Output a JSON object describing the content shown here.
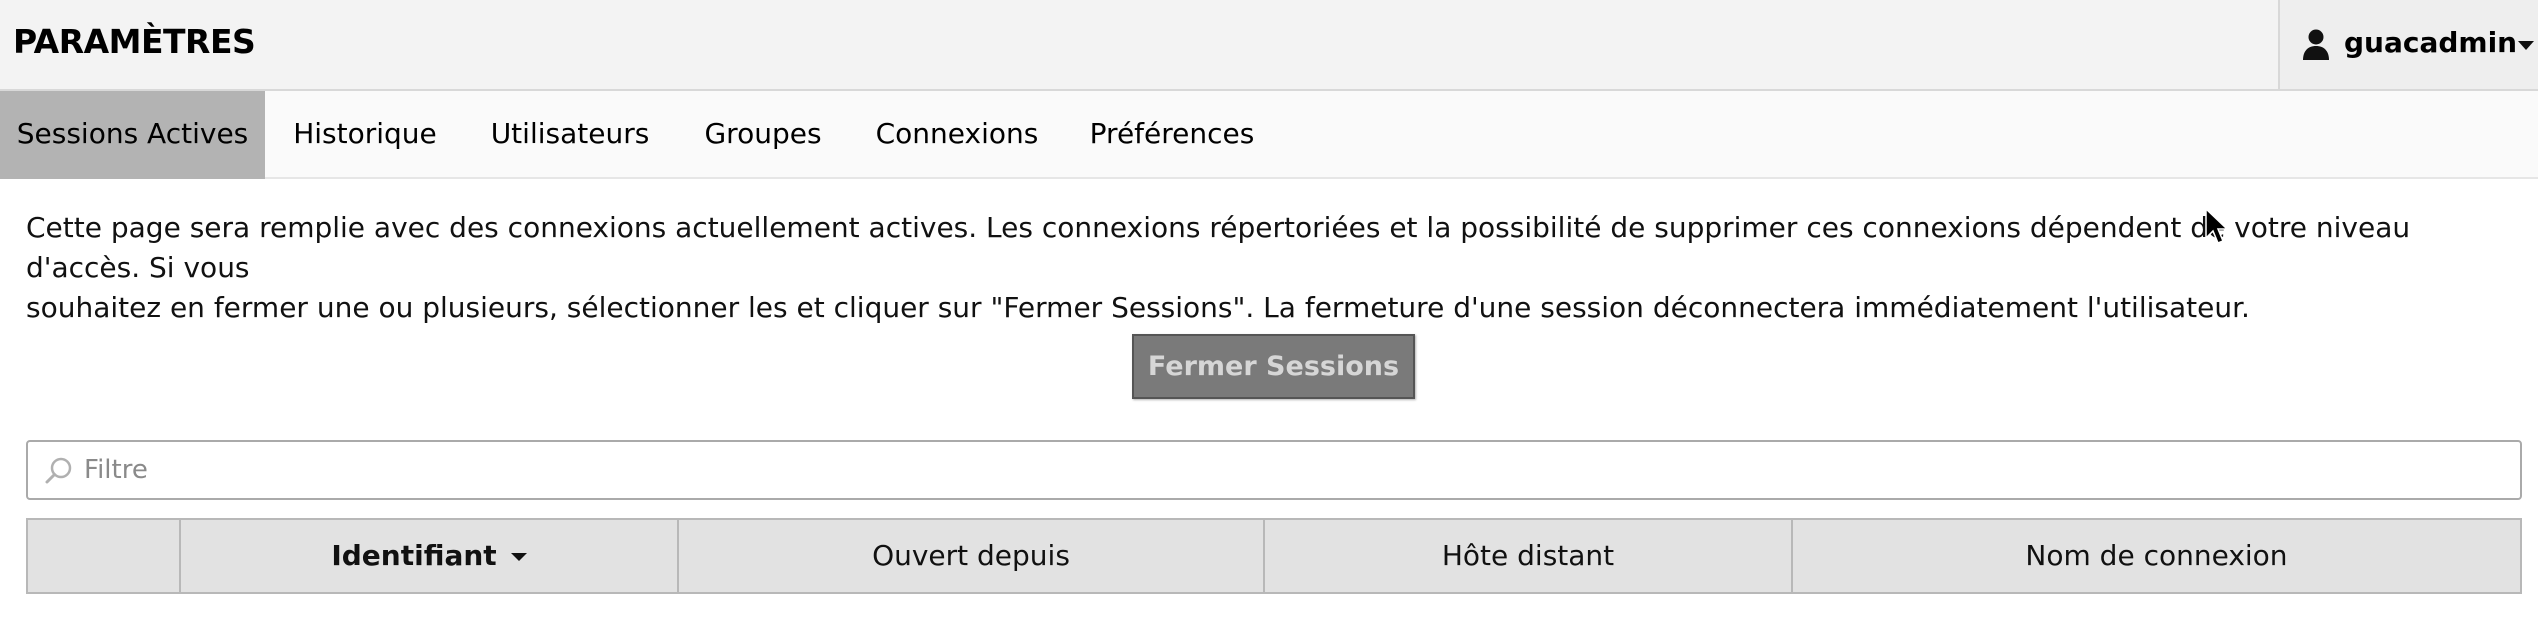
{
  "header": {
    "title": "PARAMÈTRES",
    "user": {
      "name": "guacadmin",
      "icon": "user-icon"
    }
  },
  "tabs": [
    {
      "label": "Sessions Actives",
      "active": true
    },
    {
      "label": "Historique",
      "active": false
    },
    {
      "label": "Utilisateurs",
      "active": false
    },
    {
      "label": "Groupes",
      "active": false
    },
    {
      "label": "Connexions",
      "active": false
    },
    {
      "label": "Préférences",
      "active": false
    }
  ],
  "description": {
    "line1": "Cette page sera remplie avec des connexions actuellement actives. Les connexions répertoriées et la possibilité de supprimer ces connexions dépendent de votre niveau d'accès. Si vous",
    "line2": "souhaitez en fermer une ou plusieurs, sélectionner les et cliquer sur \"Fermer Sessions\". La fermeture d'une session déconnectera immédiatement l'utilisateur."
  },
  "actions": {
    "close_sessions_label": "Fermer Sessions"
  },
  "filter": {
    "placeholder": "Filtre",
    "value": "",
    "icon": "search-icon"
  },
  "table": {
    "columns": [
      {
        "label": "",
        "sorted": false
      },
      {
        "label": "Identifiant",
        "sorted": true,
        "sort_direction": "descending"
      },
      {
        "label": "Ouvert depuis",
        "sorted": false
      },
      {
        "label": "Hôte distant",
        "sorted": false
      },
      {
        "label": "Nom de connexion",
        "sorted": false
      }
    ],
    "rows": []
  },
  "colors": {
    "header_bg": "#f3f3f3",
    "active_tab_bg": "#b3b3b3",
    "button_bg": "#7a7a7a",
    "table_header_bg": "#e2e2e2"
  }
}
